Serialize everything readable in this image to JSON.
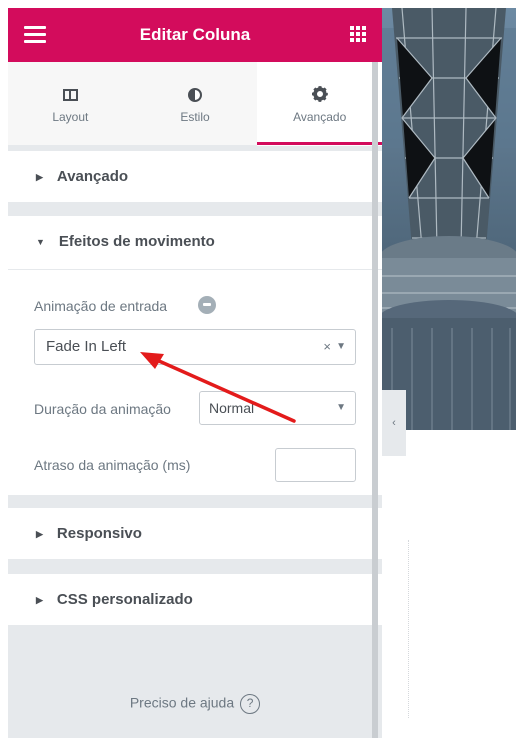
{
  "header": {
    "title": "Editar Coluna"
  },
  "tabs": [
    {
      "label": "Layout",
      "icon": "layout-columns-icon"
    },
    {
      "label": "Estilo",
      "icon": "half-circle-style-icon"
    },
    {
      "label": "Avançado",
      "icon": "gear-icon",
      "active": true
    }
  ],
  "sections": {
    "advanced": {
      "label": "Avançado",
      "expanded": false
    },
    "motion": {
      "label": "Efeitos de movimento",
      "expanded": true,
      "entrance_label": "Animação de entrada",
      "entrance_value": "Fade In Left",
      "duration_label": "Duração da animação",
      "duration_value": "Normal",
      "delay_label": "Atraso da animação (ms)",
      "delay_value": ""
    },
    "responsive": {
      "label": "Responsivo",
      "expanded": false
    },
    "custom_css": {
      "label": "CSS personalizado",
      "expanded": false
    }
  },
  "help": {
    "label": "Preciso de ajuda",
    "icon": "question-circle-icon"
  },
  "colors": {
    "brand": "#d30c5c",
    "annotation": "#e31b1b",
    "panel_bg": "#e6e9ec",
    "text": "#4a4f55"
  }
}
